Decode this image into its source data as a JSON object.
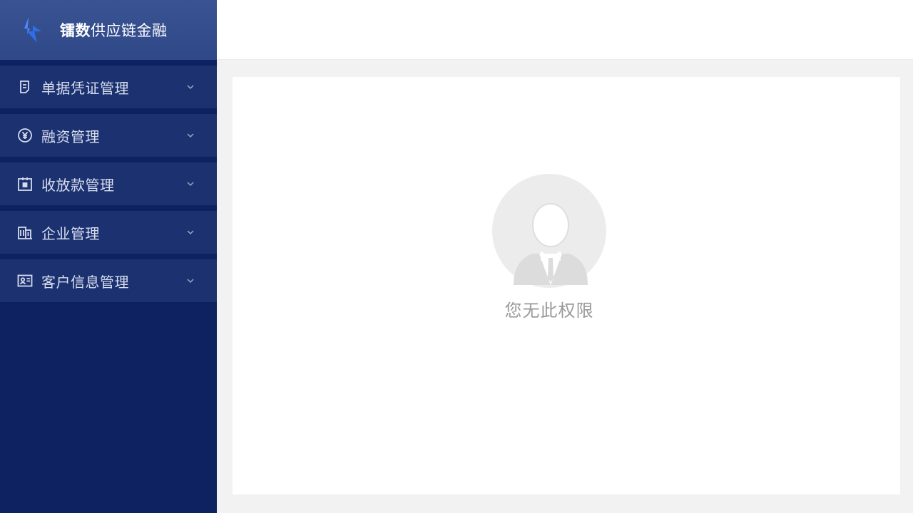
{
  "brand": {
    "name_strong": "镭数",
    "name_rest": "供应链金融",
    "logo_icon": "lightning-icon"
  },
  "sidebar": {
    "items": [
      {
        "label": "单据凭证管理",
        "icon": "document-icon"
      },
      {
        "label": "融资管理",
        "icon": "yuan-coin-icon"
      },
      {
        "label": "收放款管理",
        "icon": "wallet-icon"
      },
      {
        "label": "企业管理",
        "icon": "building-icon"
      },
      {
        "label": "客户信息管理",
        "icon": "id-card-icon"
      }
    ]
  },
  "main": {
    "empty_state": {
      "icon": "user-avatar-icon",
      "message": "您无此权限"
    }
  },
  "colors": {
    "sidebar_bg": "#0e2262",
    "brand_bg": "#3a5393",
    "menu_item_bg": "#1c3170",
    "accent": "#3b7cff"
  }
}
